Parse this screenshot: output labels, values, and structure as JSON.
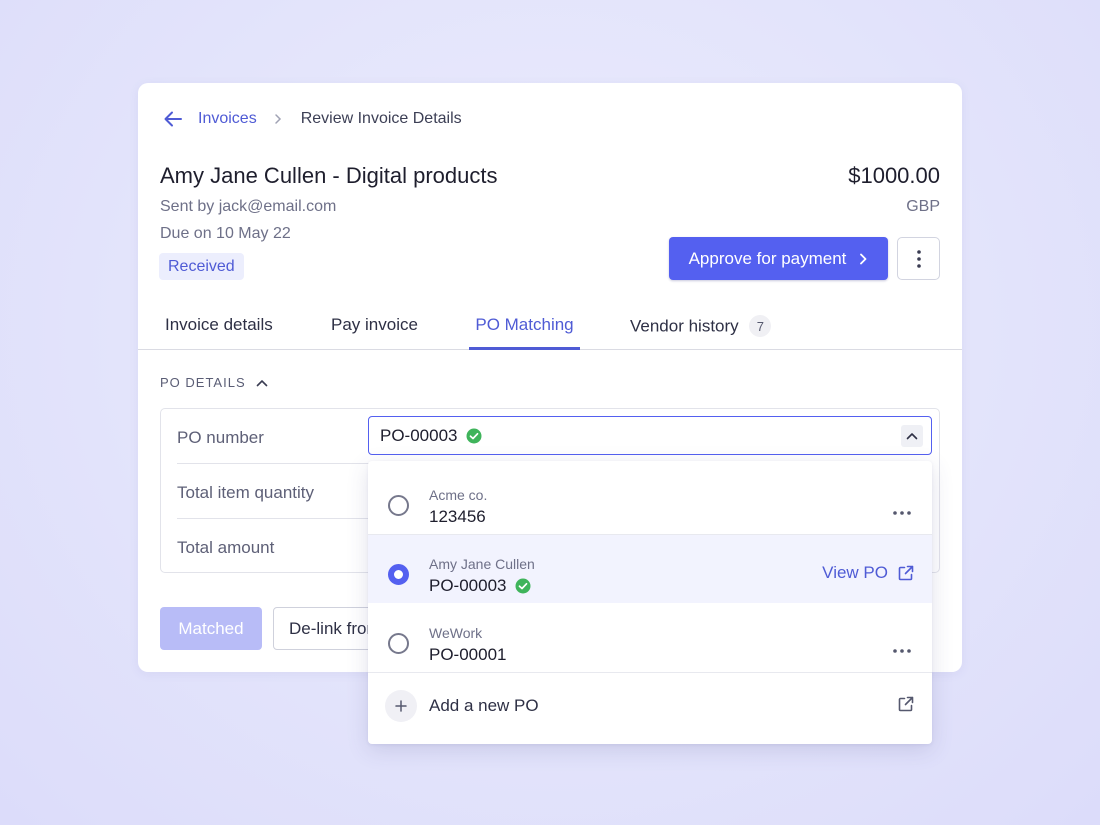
{
  "breadcrumb": {
    "parent": "Invoices",
    "current": "Review Invoice Details"
  },
  "invoice": {
    "title": "Amy Jane Cullen - Digital products",
    "sender": "Sent by jack@email.com",
    "due": "Due on 10 May 22",
    "status": "Received",
    "amount": "$1000.00",
    "currency": "GBP"
  },
  "actions": {
    "approve_label": "Approve for payment"
  },
  "tabs": [
    {
      "label": "Invoice details"
    },
    {
      "label": "Pay invoice"
    },
    {
      "label": "PO Matching",
      "active": true
    },
    {
      "label": "Vendor history",
      "count": "7"
    }
  ],
  "po_section": {
    "title": "PO DETAILS",
    "rows": [
      "PO number",
      "Total item quantity",
      "Total amount"
    ],
    "selected_po": "PO-00003",
    "matched_label": "Matched",
    "delink_label": "De-link from"
  },
  "dropdown": {
    "options": [
      {
        "vendor": "Acme co.",
        "po": "123456",
        "selected": false
      },
      {
        "vendor": "Amy Jane Cullen",
        "po": "PO-00003",
        "selected": true,
        "verified": true,
        "view_label": "View PO"
      },
      {
        "vendor": "WeWork",
        "po": "PO-00001",
        "selected": false
      }
    ],
    "add_label": "Add a new PO"
  },
  "colors": {
    "accent": "#5460f0",
    "success": "#3fb45b",
    "background": "#e2e3fb"
  }
}
